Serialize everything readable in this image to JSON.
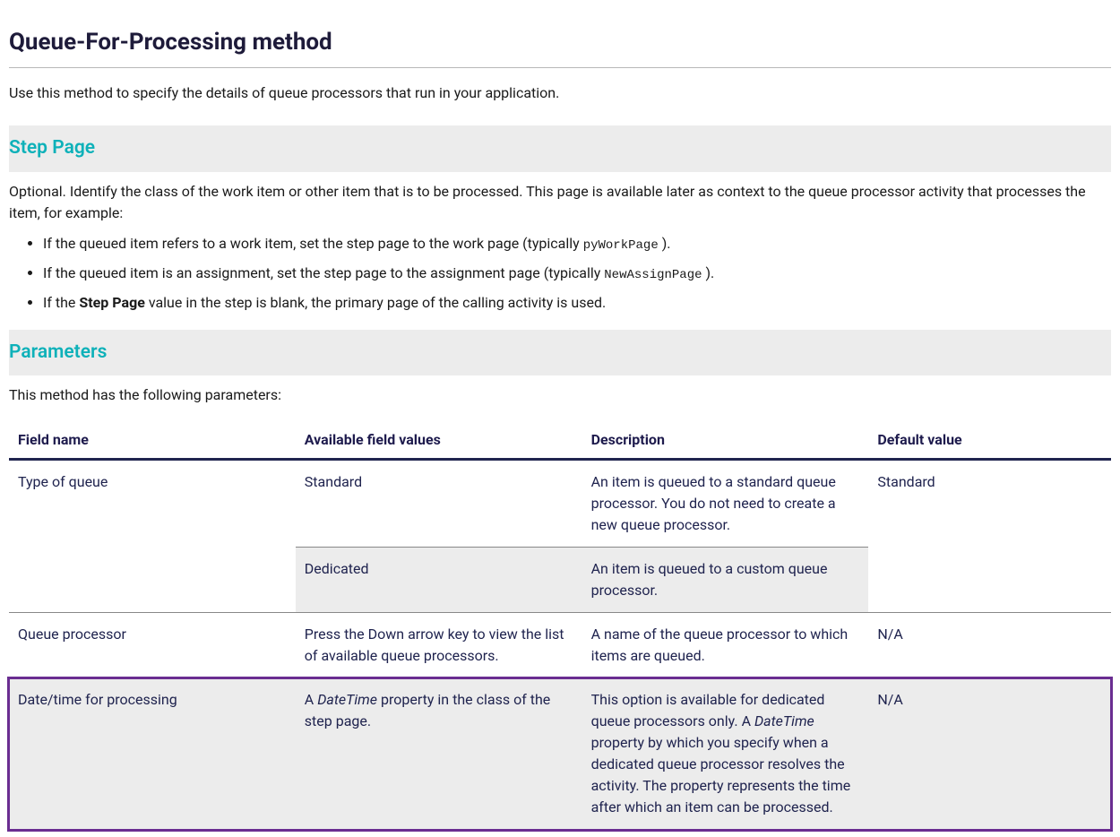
{
  "title": "Queue-For-Processing method",
  "intro": "Use this method to specify the details of queue processors that run in your application.",
  "stepPage": {
    "heading": "Step Page",
    "lead": "Optional. Identify the class of the work item or other item that is to be processed. This page is available later as context to the queue processor activity that processes the item, for example:",
    "item1_pre": "If the queued item refers to a work item, set the step page to the work page (typically ",
    "item1_code": "pyWorkPage",
    "item1_post": " ).",
    "item2_pre": "If the queued item is an assignment, set the step page to the assignment page (typically ",
    "item2_code": "NewAssignPage",
    "item2_post": " ).",
    "item3_pre": "If the ",
    "item3_strong": "Step Page",
    "item3_post": " value in the step is blank, the primary page of the calling activity is used."
  },
  "parameters": {
    "heading": "Parameters",
    "lead": "This method has the following parameters:",
    "headers": {
      "field": "Field name",
      "values": "Available field values",
      "desc": "Description",
      "default": "Default value"
    },
    "row1": {
      "field": "Type of queue",
      "value_a": "Standard",
      "desc_a": "An item is queued to a standard queue processor. You do not need to create a new queue processor.",
      "value_b": "Dedicated",
      "desc_b": "An item is queued to a custom queue processor.",
      "default": "Standard"
    },
    "row2": {
      "field": "Queue processor",
      "value": "Press the Down arrow key to view the list of available queue processors.",
      "desc": "A name of the queue processor to which items are queued.",
      "default": "N/A"
    },
    "row3": {
      "field": "Date/time for processing",
      "value_pre": "A ",
      "value_em": "DateTime",
      "value_post": " property in the class of the step page.",
      "desc_pre": "This option is available for dedicated queue processors only. A ",
      "desc_em": "DateTime",
      "desc_post": " property by which you specify when a dedicated queue processor resolves the activity. The property represents the time after which an item can be processed.",
      "default": "N/A"
    }
  }
}
